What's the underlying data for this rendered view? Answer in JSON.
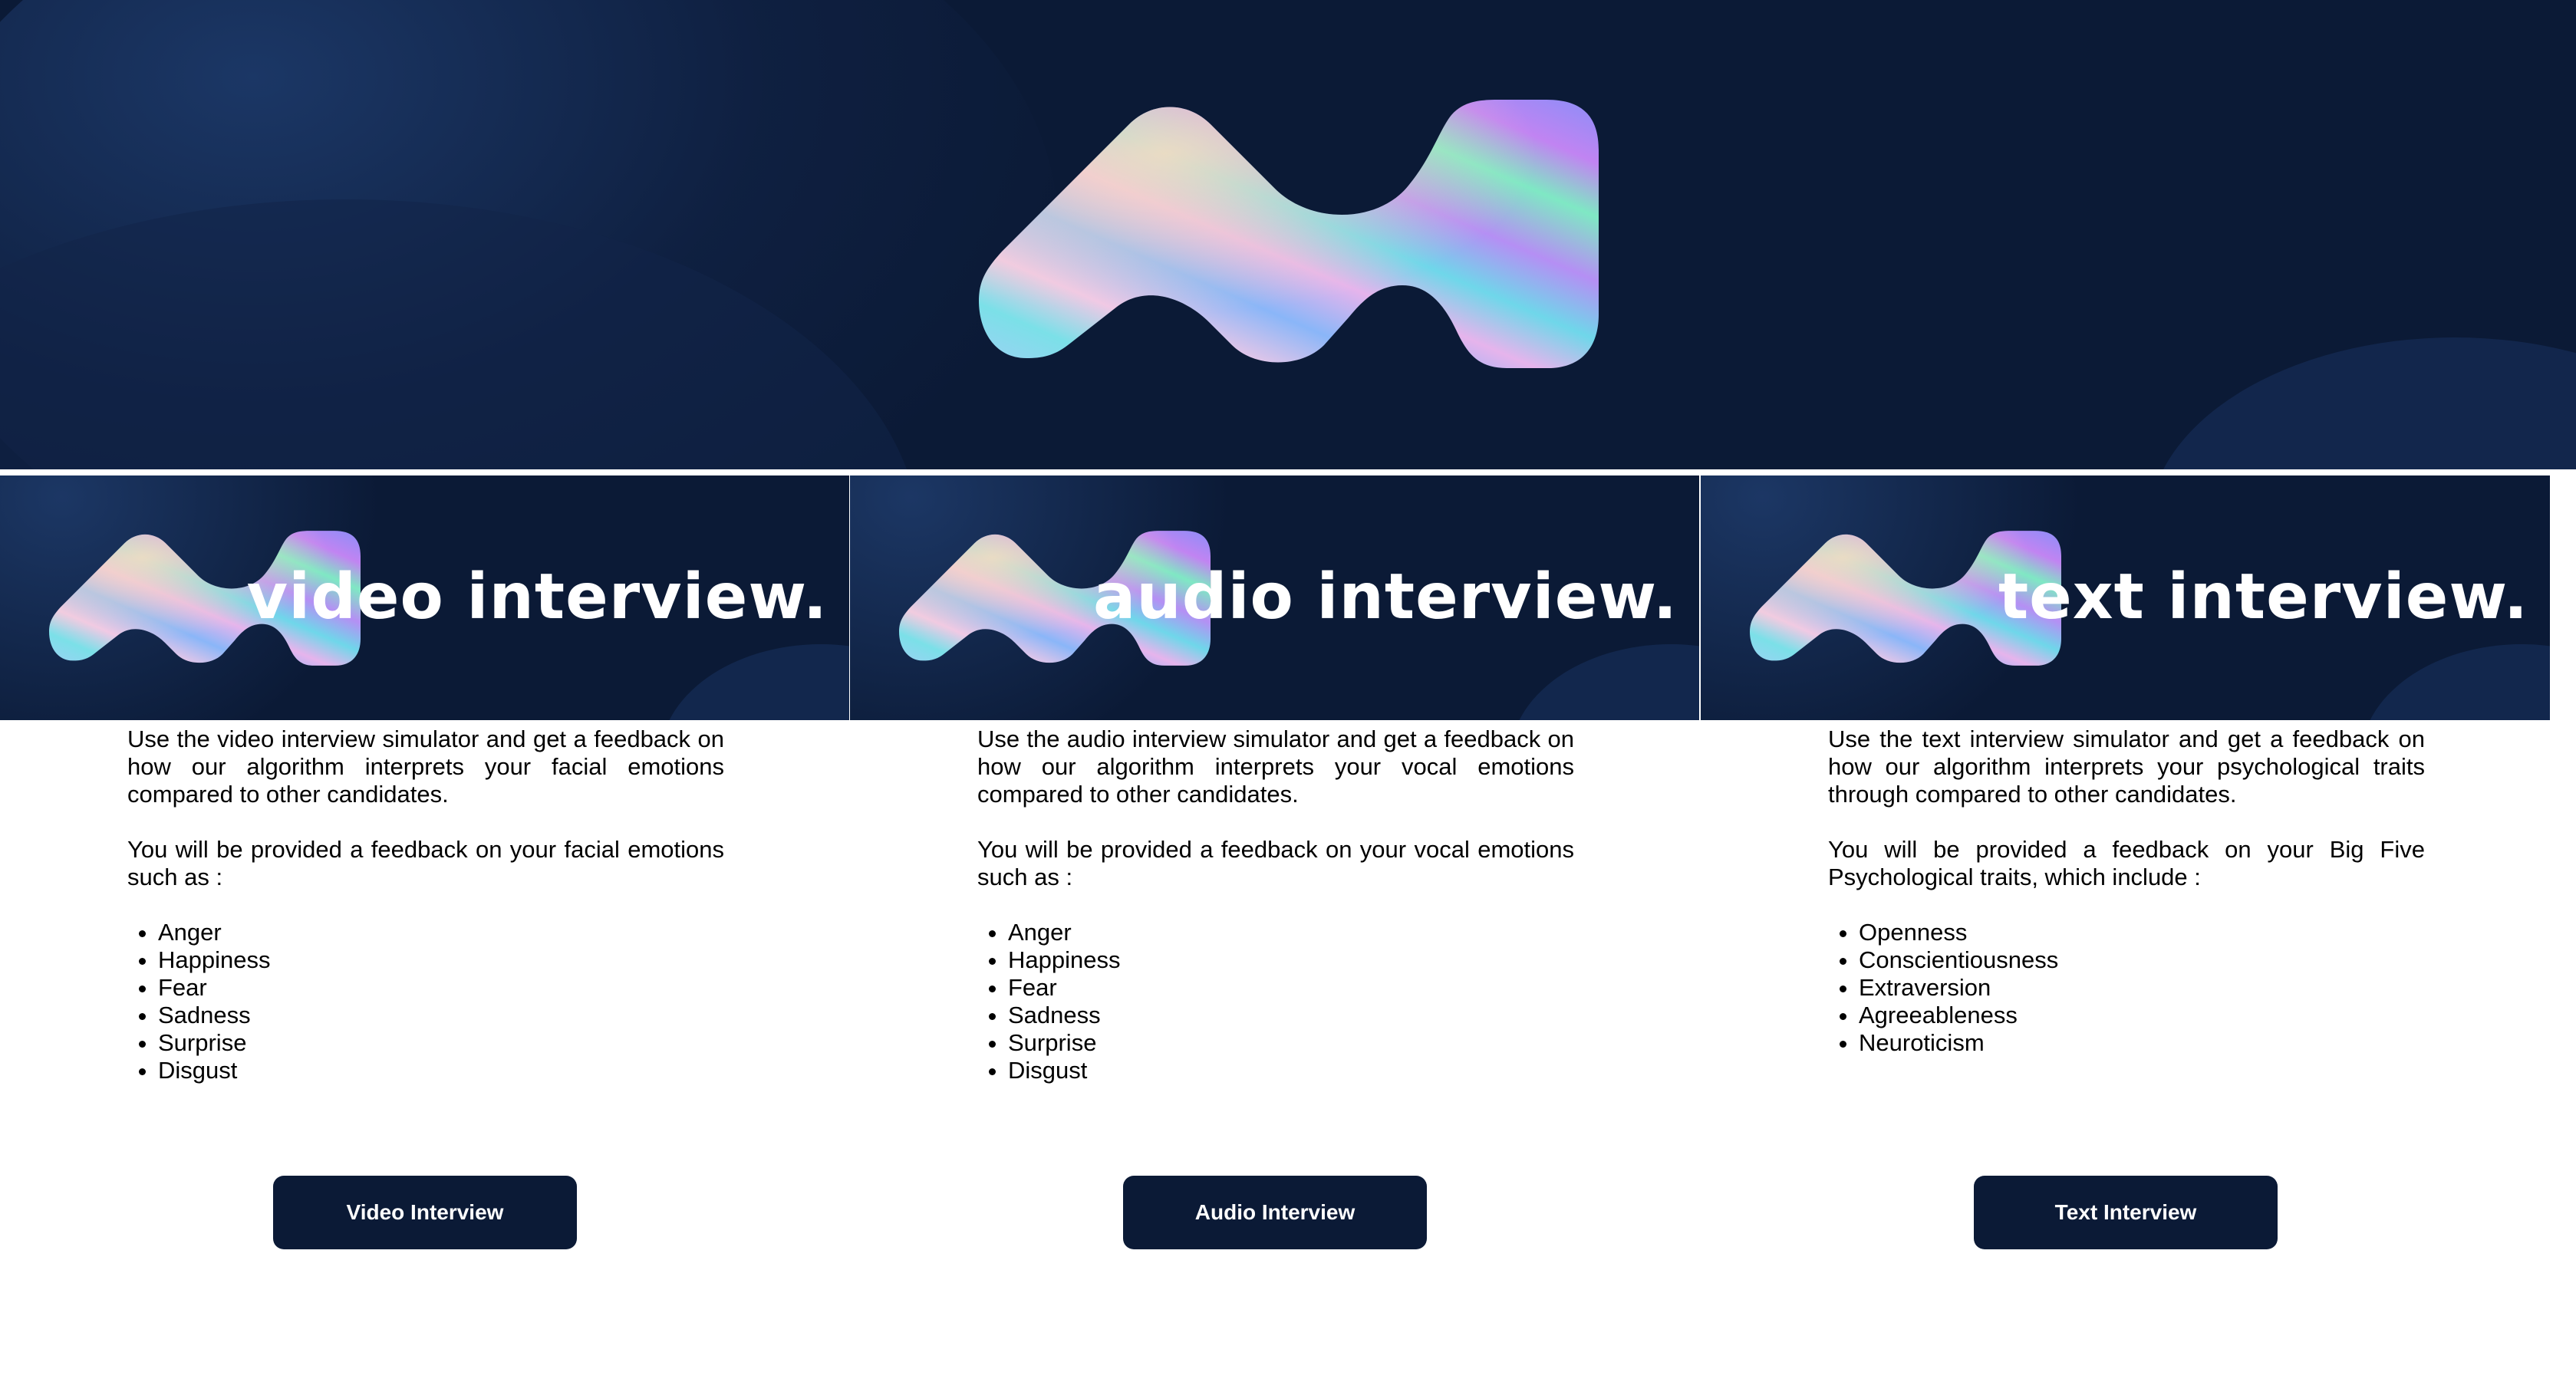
{
  "hero": {
    "logo_icon": "holographic-wave-logo-icon"
  },
  "columns": [
    {
      "banner_title": "video interview.",
      "description": "Use the video interview simulator and get a feedback on how our algorithm interprets your facial emotions compared to other candidates.",
      "feedback_intro": "You will be provided a feedback on your facial emotions such as :",
      "items": [
        "Anger",
        "Happiness",
        "Fear",
        "Sadness",
        "Surprise",
        "Disgust"
      ],
      "button_label": "Video Interview"
    },
    {
      "banner_title": "audio interview.",
      "description": "Use the audio interview simulator and get a feedback on how our algorithm interprets your vocal emotions compared to other candidates.",
      "feedback_intro": "You will be provided a feedback on your vocal emotions such as :",
      "items": [
        "Anger",
        "Happiness",
        "Fear",
        "Sadness",
        "Surprise",
        "Disgust"
      ],
      "button_label": "Audio Interview"
    },
    {
      "banner_title": "text interview.",
      "description": "Use the text interview simulator and get a feedback on how our algorithm interprets your psychological traits through compared to other candidates.",
      "feedback_intro": "You will be provided a feedback on your Big Five Psychological traits, which include :",
      "items": [
        "Openness",
        "Conscientiousness",
        "Extraversion",
        "Agreeableness",
        "Neuroticism"
      ],
      "button_label": "Text Interview"
    }
  ],
  "colors": {
    "navy": "#0b1a36",
    "text": "#000000",
    "button_text": "#ffffff"
  }
}
